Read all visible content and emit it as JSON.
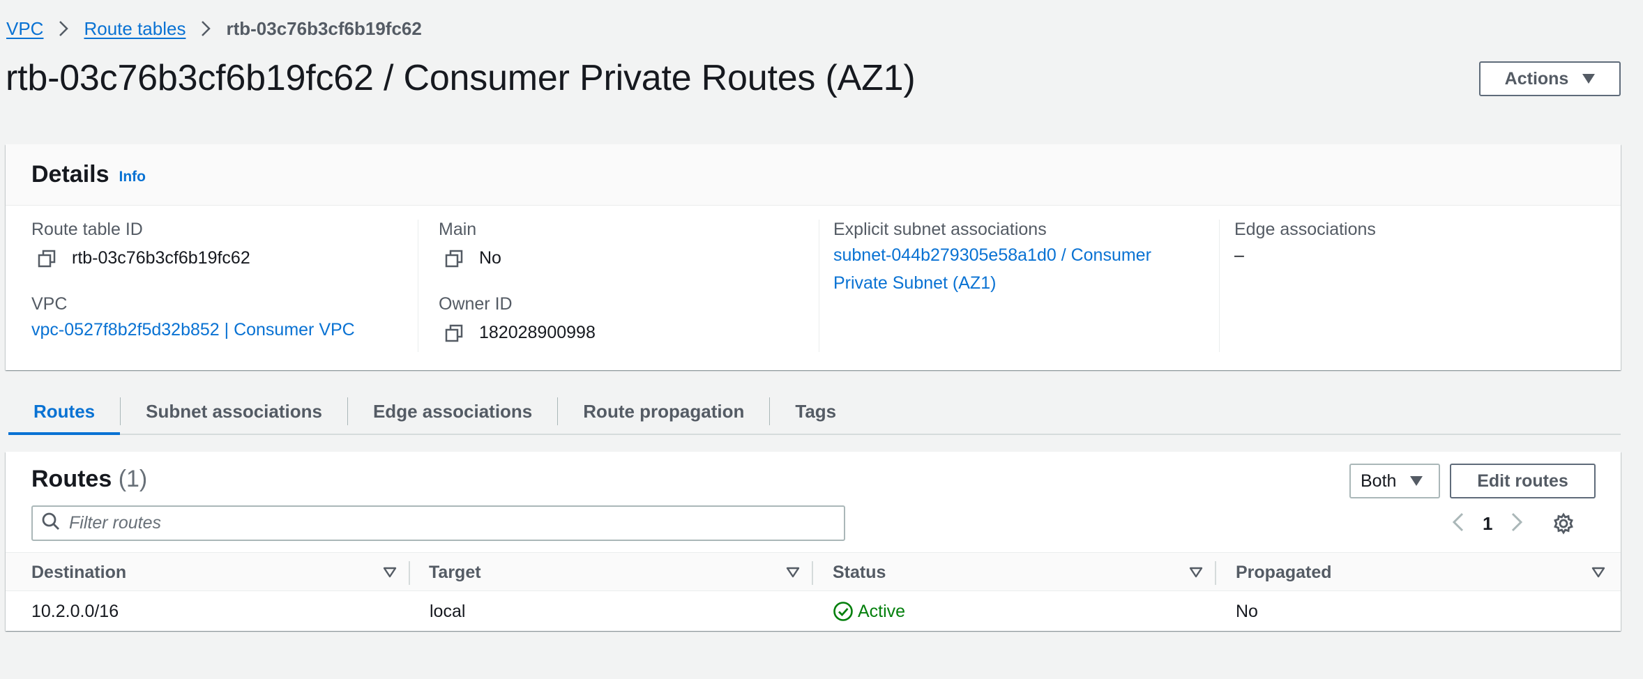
{
  "breadcrumbs": [
    {
      "label": "VPC"
    },
    {
      "label": "Route tables"
    },
    {
      "label": "rtb-03c76b3cf6b19fc62"
    }
  ],
  "page": {
    "title": "rtb-03c76b3cf6b19fc62 / Consumer Private Routes (AZ1)",
    "actions_label": "Actions"
  },
  "details": {
    "title": "Details",
    "info_label": "Info",
    "route_table_id_label": "Route table ID",
    "route_table_id": "rtb-03c76b3cf6b19fc62",
    "vpc_label": "VPC",
    "vpc_value": "vpc-0527f8b2f5d32b852 | Consumer VPC",
    "main_label": "Main",
    "main_value": "No",
    "owner_id_label": "Owner ID",
    "owner_id": "182028900998",
    "explicit_subnet_label": "Explicit subnet associations",
    "explicit_subnet_line1": "subnet-044b279305e58a1d0 / Consumer",
    "explicit_subnet_line2": "Private Subnet (AZ1)",
    "edge_label": "Edge associations",
    "edge_value": "–"
  },
  "tabs": [
    {
      "label": "Routes",
      "active": true
    },
    {
      "label": "Subnet associations",
      "active": false
    },
    {
      "label": "Edge associations",
      "active": false
    },
    {
      "label": "Route propagation",
      "active": false
    },
    {
      "label": "Tags",
      "active": false
    }
  ],
  "routes": {
    "title": "Routes",
    "count": "(1)",
    "filter_select": "Both",
    "edit_label": "Edit routes",
    "search_placeholder": "Filter routes",
    "page_number": "1",
    "columns": [
      "Destination",
      "Target",
      "Status",
      "Propagated"
    ],
    "rows": [
      {
        "destination": "10.2.0.0/16",
        "target": "local",
        "status": "Active",
        "propagated": "No"
      }
    ]
  },
  "colors": {
    "link": "#0972d3",
    "status_active": "#037f0c",
    "background": "#f2f3f3"
  },
  "icons": [
    "chevron-right-icon",
    "caret-down-icon",
    "copy-icon",
    "search-icon",
    "chevron-left-icon",
    "gear-icon",
    "sort-icon",
    "status-check-icon"
  ]
}
